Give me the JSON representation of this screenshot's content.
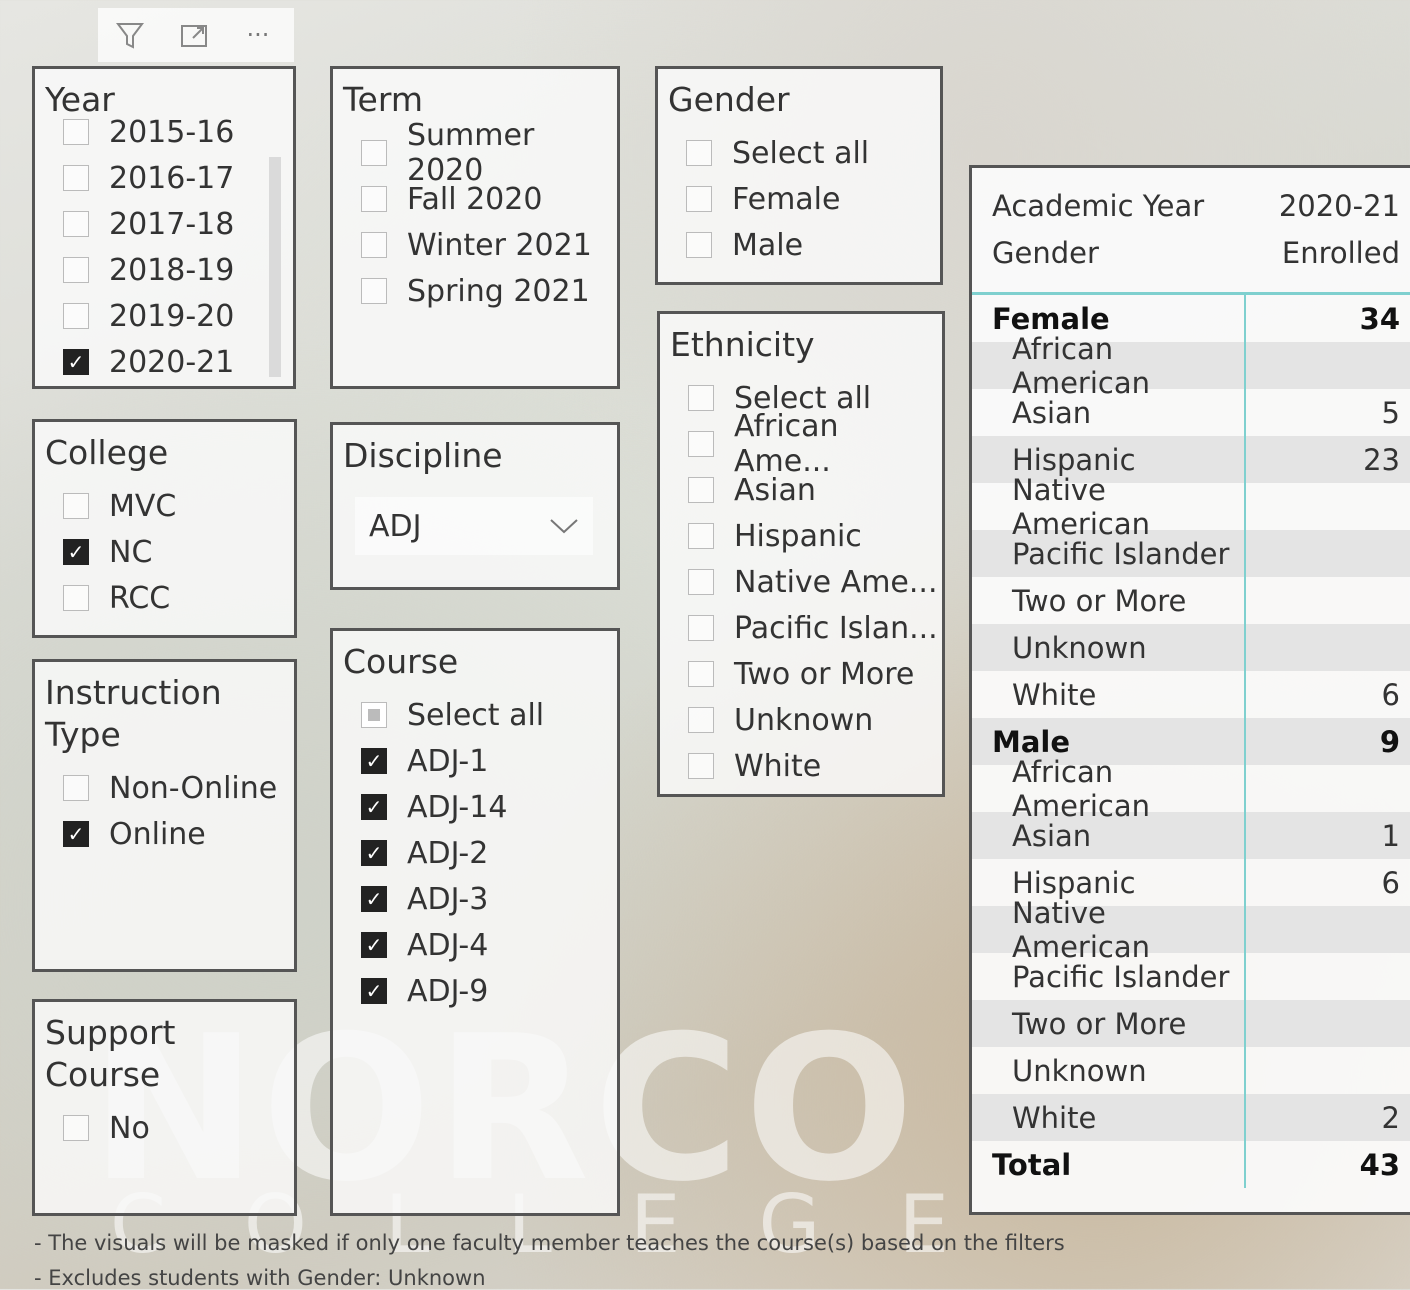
{
  "toolbar": {
    "icons": [
      "filter-icon",
      "focus-mode-icon",
      "more-options-icon"
    ],
    "more_glyph": "···"
  },
  "watermark": {
    "main": "NORCO",
    "sub": "COLLEGE"
  },
  "year": {
    "title": "Year",
    "items": [
      {
        "label": "2015-16",
        "checked": false
      },
      {
        "label": "2016-17",
        "checked": false
      },
      {
        "label": "2017-18",
        "checked": false
      },
      {
        "label": "2018-19",
        "checked": false
      },
      {
        "label": "2019-20",
        "checked": false
      },
      {
        "label": "2020-21",
        "checked": true
      }
    ]
  },
  "term": {
    "title": "Term",
    "items": [
      {
        "label": "Summer 2020",
        "checked": false
      },
      {
        "label": "Fall 2020",
        "checked": false
      },
      {
        "label": "Winter 2021",
        "checked": false
      },
      {
        "label": "Spring 2021",
        "checked": false
      }
    ]
  },
  "gender": {
    "title": "Gender",
    "items": [
      {
        "label": "Select all",
        "checked": false
      },
      {
        "label": "Female",
        "checked": false
      },
      {
        "label": "Male",
        "checked": false
      }
    ]
  },
  "college": {
    "title": "College",
    "items": [
      {
        "label": "MVC",
        "checked": false
      },
      {
        "label": "NC",
        "checked": true
      },
      {
        "label": "RCC",
        "checked": false
      }
    ]
  },
  "discipline": {
    "title": "Discipline",
    "selected": "ADJ"
  },
  "ethnicity": {
    "title": "Ethnicity",
    "items": [
      {
        "label": "Select all",
        "checked": false
      },
      {
        "label": "African Ame...",
        "checked": false
      },
      {
        "label": "Asian",
        "checked": false
      },
      {
        "label": "Hispanic",
        "checked": false
      },
      {
        "label": "Native Ame...",
        "checked": false
      },
      {
        "label": "Pacific Islan...",
        "checked": false
      },
      {
        "label": "Two or More",
        "checked": false
      },
      {
        "label": "Unknown",
        "checked": false
      },
      {
        "label": "White",
        "checked": false
      }
    ]
  },
  "instruction": {
    "title_line1": "Instruction",
    "title_line2": "Type",
    "items": [
      {
        "label": "Non-Online",
        "checked": false
      },
      {
        "label": "Online",
        "checked": true
      }
    ]
  },
  "course": {
    "title": "Course",
    "items": [
      {
        "label": "Select all",
        "checked": "partial"
      },
      {
        "label": "ADJ-1",
        "checked": true
      },
      {
        "label": "ADJ-14",
        "checked": true
      },
      {
        "label": "ADJ-2",
        "checked": true
      },
      {
        "label": "ADJ-3",
        "checked": true
      },
      {
        "label": "ADJ-4",
        "checked": true
      },
      {
        "label": "ADJ-9",
        "checked": true
      }
    ]
  },
  "support": {
    "title_line1": "Support",
    "title_line2": "Course",
    "items": [
      {
        "label": "No",
        "checked": false
      }
    ]
  },
  "matrix": {
    "header1": [
      "Academic Year",
      "2020-21"
    ],
    "header2": [
      "Gender",
      "Enrolled"
    ],
    "rows": [
      {
        "label": "Female",
        "value": "34",
        "level": "group"
      },
      {
        "label": "African American",
        "value": "",
        "level": "sub"
      },
      {
        "label": "Asian",
        "value": "5",
        "level": "sub"
      },
      {
        "label": "Hispanic",
        "value": "23",
        "level": "sub"
      },
      {
        "label": "Native American",
        "value": "",
        "level": "sub"
      },
      {
        "label": "Pacific Islander",
        "value": "",
        "level": "sub"
      },
      {
        "label": "Two or More",
        "value": "",
        "level": "sub"
      },
      {
        "label": "Unknown",
        "value": "",
        "level": "sub"
      },
      {
        "label": "White",
        "value": "6",
        "level": "sub"
      },
      {
        "label": "Male",
        "value": "9",
        "level": "group"
      },
      {
        "label": "African American",
        "value": "",
        "level": "sub"
      },
      {
        "label": "Asian",
        "value": "1",
        "level": "sub"
      },
      {
        "label": "Hispanic",
        "value": "6",
        "level": "sub"
      },
      {
        "label": "Native American",
        "value": "",
        "level": "sub"
      },
      {
        "label": "Pacific Islander",
        "value": "",
        "level": "sub"
      },
      {
        "label": "Two or More",
        "value": "",
        "level": "sub"
      },
      {
        "label": "Unknown",
        "value": "",
        "level": "sub"
      },
      {
        "label": "White",
        "value": "2",
        "level": "sub"
      },
      {
        "label": "Total",
        "value": "43",
        "level": "group"
      }
    ]
  },
  "notes": [
    "- The visuals will be masked if only one faculty member teaches the course(s) based on the filters",
    "- Excludes students with Gender: Unknown"
  ]
}
